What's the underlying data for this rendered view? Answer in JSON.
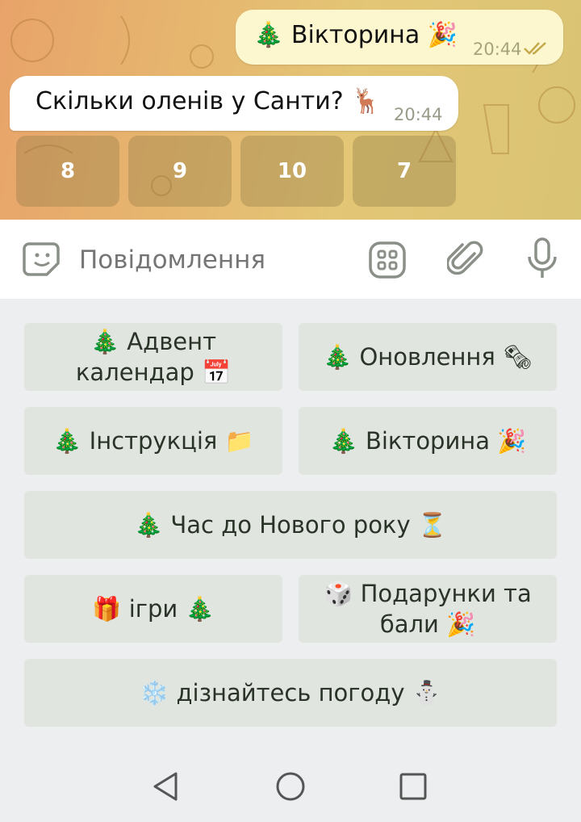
{
  "chat": {
    "outgoing": {
      "text": "🎄 Вікторина 🎉",
      "time": "20:44"
    },
    "incoming": {
      "text": "Скільки оленів у Санти? 🦌",
      "time": "20:44"
    },
    "quiz_options": [
      "8",
      "9",
      "10",
      "7"
    ]
  },
  "composer": {
    "placeholder": "Повідомлення"
  },
  "keyboard": {
    "buttons": [
      "🎄 Адвент календар 📅",
      "🎄 Оновлення 🗞",
      "🎄 Інструкція 📁",
      "🎄 Вікторина 🎉",
      "🎄 Час до Нового року ⏳",
      "🎁 ігри 🎄",
      "🎲 Подарунки та бали 🎉",
      "❄️ дізнайтесь погоду ⛄"
    ]
  },
  "colors": {
    "chat_gradient_start": "#e8a36a",
    "chat_gradient_end": "#d9c474",
    "outgoing_bubble": "#fdf7d0",
    "keyboard_button": "#e1e5e0",
    "icon_gray": "#8a9088"
  }
}
